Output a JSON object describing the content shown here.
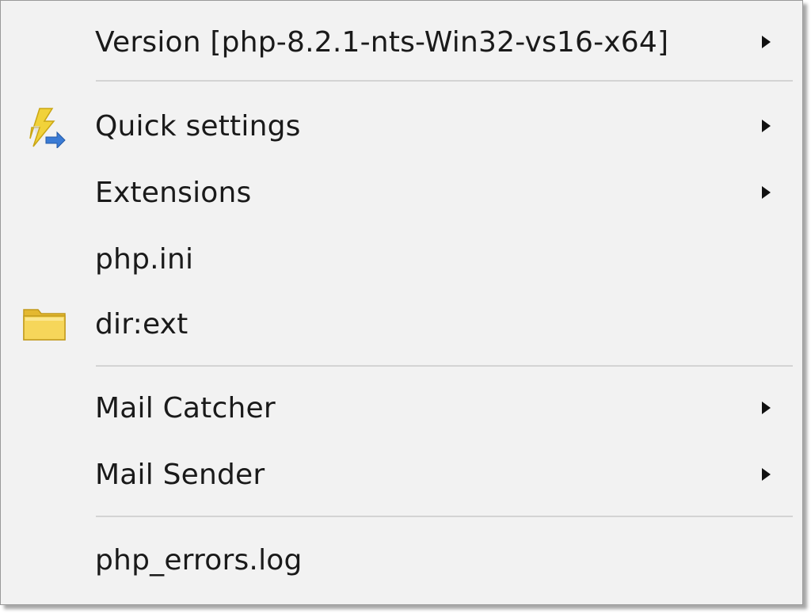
{
  "menu": {
    "items": [
      {
        "label": "Version [php-8.2.1-nts-Win32-vs16-x64]",
        "submenu": true,
        "icon": ""
      },
      {
        "label": "Quick settings",
        "submenu": true,
        "icon": "lightning-settings-icon"
      },
      {
        "label": "Extensions",
        "submenu": true,
        "icon": ""
      },
      {
        "label": "php.ini",
        "submenu": false,
        "icon": ""
      },
      {
        "label": "dir:ext",
        "submenu": false,
        "icon": "folder-icon"
      },
      {
        "label": "Mail Catcher",
        "submenu": true,
        "icon": ""
      },
      {
        "label": "Mail Sender",
        "submenu": true,
        "icon": ""
      },
      {
        "label": "php_errors.log",
        "submenu": false,
        "icon": ""
      }
    ]
  },
  "colors": {
    "menu_background": "#f2f2f2",
    "text": "#1a1a1a",
    "separator": "#d4d4d4",
    "folder_yellow": "#f3cf4a",
    "lightning_yellow": "#f1d23a",
    "arrow_blue": "#3a7bd5"
  }
}
